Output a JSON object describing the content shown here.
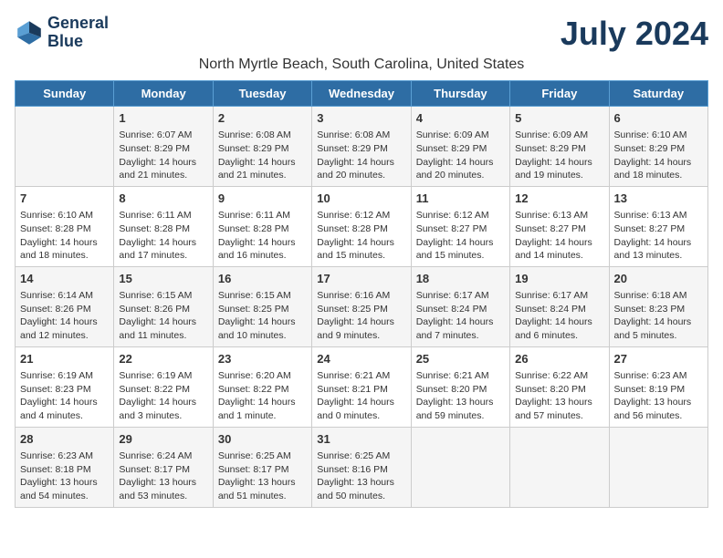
{
  "logo": {
    "line1": "General",
    "line2": "Blue"
  },
  "title": "July 2024",
  "subtitle": "North Myrtle Beach, South Carolina, United States",
  "days_of_week": [
    "Sunday",
    "Monday",
    "Tuesday",
    "Wednesday",
    "Thursday",
    "Friday",
    "Saturday"
  ],
  "weeks": [
    [
      {
        "day": "",
        "info": ""
      },
      {
        "day": "1",
        "info": "Sunrise: 6:07 AM\nSunset: 8:29 PM\nDaylight: 14 hours and 21 minutes."
      },
      {
        "day": "2",
        "info": "Sunrise: 6:08 AM\nSunset: 8:29 PM\nDaylight: 14 hours and 21 minutes."
      },
      {
        "day": "3",
        "info": "Sunrise: 6:08 AM\nSunset: 8:29 PM\nDaylight: 14 hours and 20 minutes."
      },
      {
        "day": "4",
        "info": "Sunrise: 6:09 AM\nSunset: 8:29 PM\nDaylight: 14 hours and 20 minutes."
      },
      {
        "day": "5",
        "info": "Sunrise: 6:09 AM\nSunset: 8:29 PM\nDaylight: 14 hours and 19 minutes."
      },
      {
        "day": "6",
        "info": "Sunrise: 6:10 AM\nSunset: 8:29 PM\nDaylight: 14 hours and 18 minutes."
      }
    ],
    [
      {
        "day": "7",
        "info": "Sunrise: 6:10 AM\nSunset: 8:28 PM\nDaylight: 14 hours and 18 minutes."
      },
      {
        "day": "8",
        "info": "Sunrise: 6:11 AM\nSunset: 8:28 PM\nDaylight: 14 hours and 17 minutes."
      },
      {
        "day": "9",
        "info": "Sunrise: 6:11 AM\nSunset: 8:28 PM\nDaylight: 14 hours and 16 minutes."
      },
      {
        "day": "10",
        "info": "Sunrise: 6:12 AM\nSunset: 8:28 PM\nDaylight: 14 hours and 15 minutes."
      },
      {
        "day": "11",
        "info": "Sunrise: 6:12 AM\nSunset: 8:27 PM\nDaylight: 14 hours and 15 minutes."
      },
      {
        "day": "12",
        "info": "Sunrise: 6:13 AM\nSunset: 8:27 PM\nDaylight: 14 hours and 14 minutes."
      },
      {
        "day": "13",
        "info": "Sunrise: 6:13 AM\nSunset: 8:27 PM\nDaylight: 14 hours and 13 minutes."
      }
    ],
    [
      {
        "day": "14",
        "info": "Sunrise: 6:14 AM\nSunset: 8:26 PM\nDaylight: 14 hours and 12 minutes."
      },
      {
        "day": "15",
        "info": "Sunrise: 6:15 AM\nSunset: 8:26 PM\nDaylight: 14 hours and 11 minutes."
      },
      {
        "day": "16",
        "info": "Sunrise: 6:15 AM\nSunset: 8:25 PM\nDaylight: 14 hours and 10 minutes."
      },
      {
        "day": "17",
        "info": "Sunrise: 6:16 AM\nSunset: 8:25 PM\nDaylight: 14 hours and 9 minutes."
      },
      {
        "day": "18",
        "info": "Sunrise: 6:17 AM\nSunset: 8:24 PM\nDaylight: 14 hours and 7 minutes."
      },
      {
        "day": "19",
        "info": "Sunrise: 6:17 AM\nSunset: 8:24 PM\nDaylight: 14 hours and 6 minutes."
      },
      {
        "day": "20",
        "info": "Sunrise: 6:18 AM\nSunset: 8:23 PM\nDaylight: 14 hours and 5 minutes."
      }
    ],
    [
      {
        "day": "21",
        "info": "Sunrise: 6:19 AM\nSunset: 8:23 PM\nDaylight: 14 hours and 4 minutes."
      },
      {
        "day": "22",
        "info": "Sunrise: 6:19 AM\nSunset: 8:22 PM\nDaylight: 14 hours and 3 minutes."
      },
      {
        "day": "23",
        "info": "Sunrise: 6:20 AM\nSunset: 8:22 PM\nDaylight: 14 hours and 1 minute."
      },
      {
        "day": "24",
        "info": "Sunrise: 6:21 AM\nSunset: 8:21 PM\nDaylight: 14 hours and 0 minutes."
      },
      {
        "day": "25",
        "info": "Sunrise: 6:21 AM\nSunset: 8:20 PM\nDaylight: 13 hours and 59 minutes."
      },
      {
        "day": "26",
        "info": "Sunrise: 6:22 AM\nSunset: 8:20 PM\nDaylight: 13 hours and 57 minutes."
      },
      {
        "day": "27",
        "info": "Sunrise: 6:23 AM\nSunset: 8:19 PM\nDaylight: 13 hours and 56 minutes."
      }
    ],
    [
      {
        "day": "28",
        "info": "Sunrise: 6:23 AM\nSunset: 8:18 PM\nDaylight: 13 hours and 54 minutes."
      },
      {
        "day": "29",
        "info": "Sunrise: 6:24 AM\nSunset: 8:17 PM\nDaylight: 13 hours and 53 minutes."
      },
      {
        "day": "30",
        "info": "Sunrise: 6:25 AM\nSunset: 8:17 PM\nDaylight: 13 hours and 51 minutes."
      },
      {
        "day": "31",
        "info": "Sunrise: 6:25 AM\nSunset: 8:16 PM\nDaylight: 13 hours and 50 minutes."
      },
      {
        "day": "",
        "info": ""
      },
      {
        "day": "",
        "info": ""
      },
      {
        "day": "",
        "info": ""
      }
    ]
  ]
}
